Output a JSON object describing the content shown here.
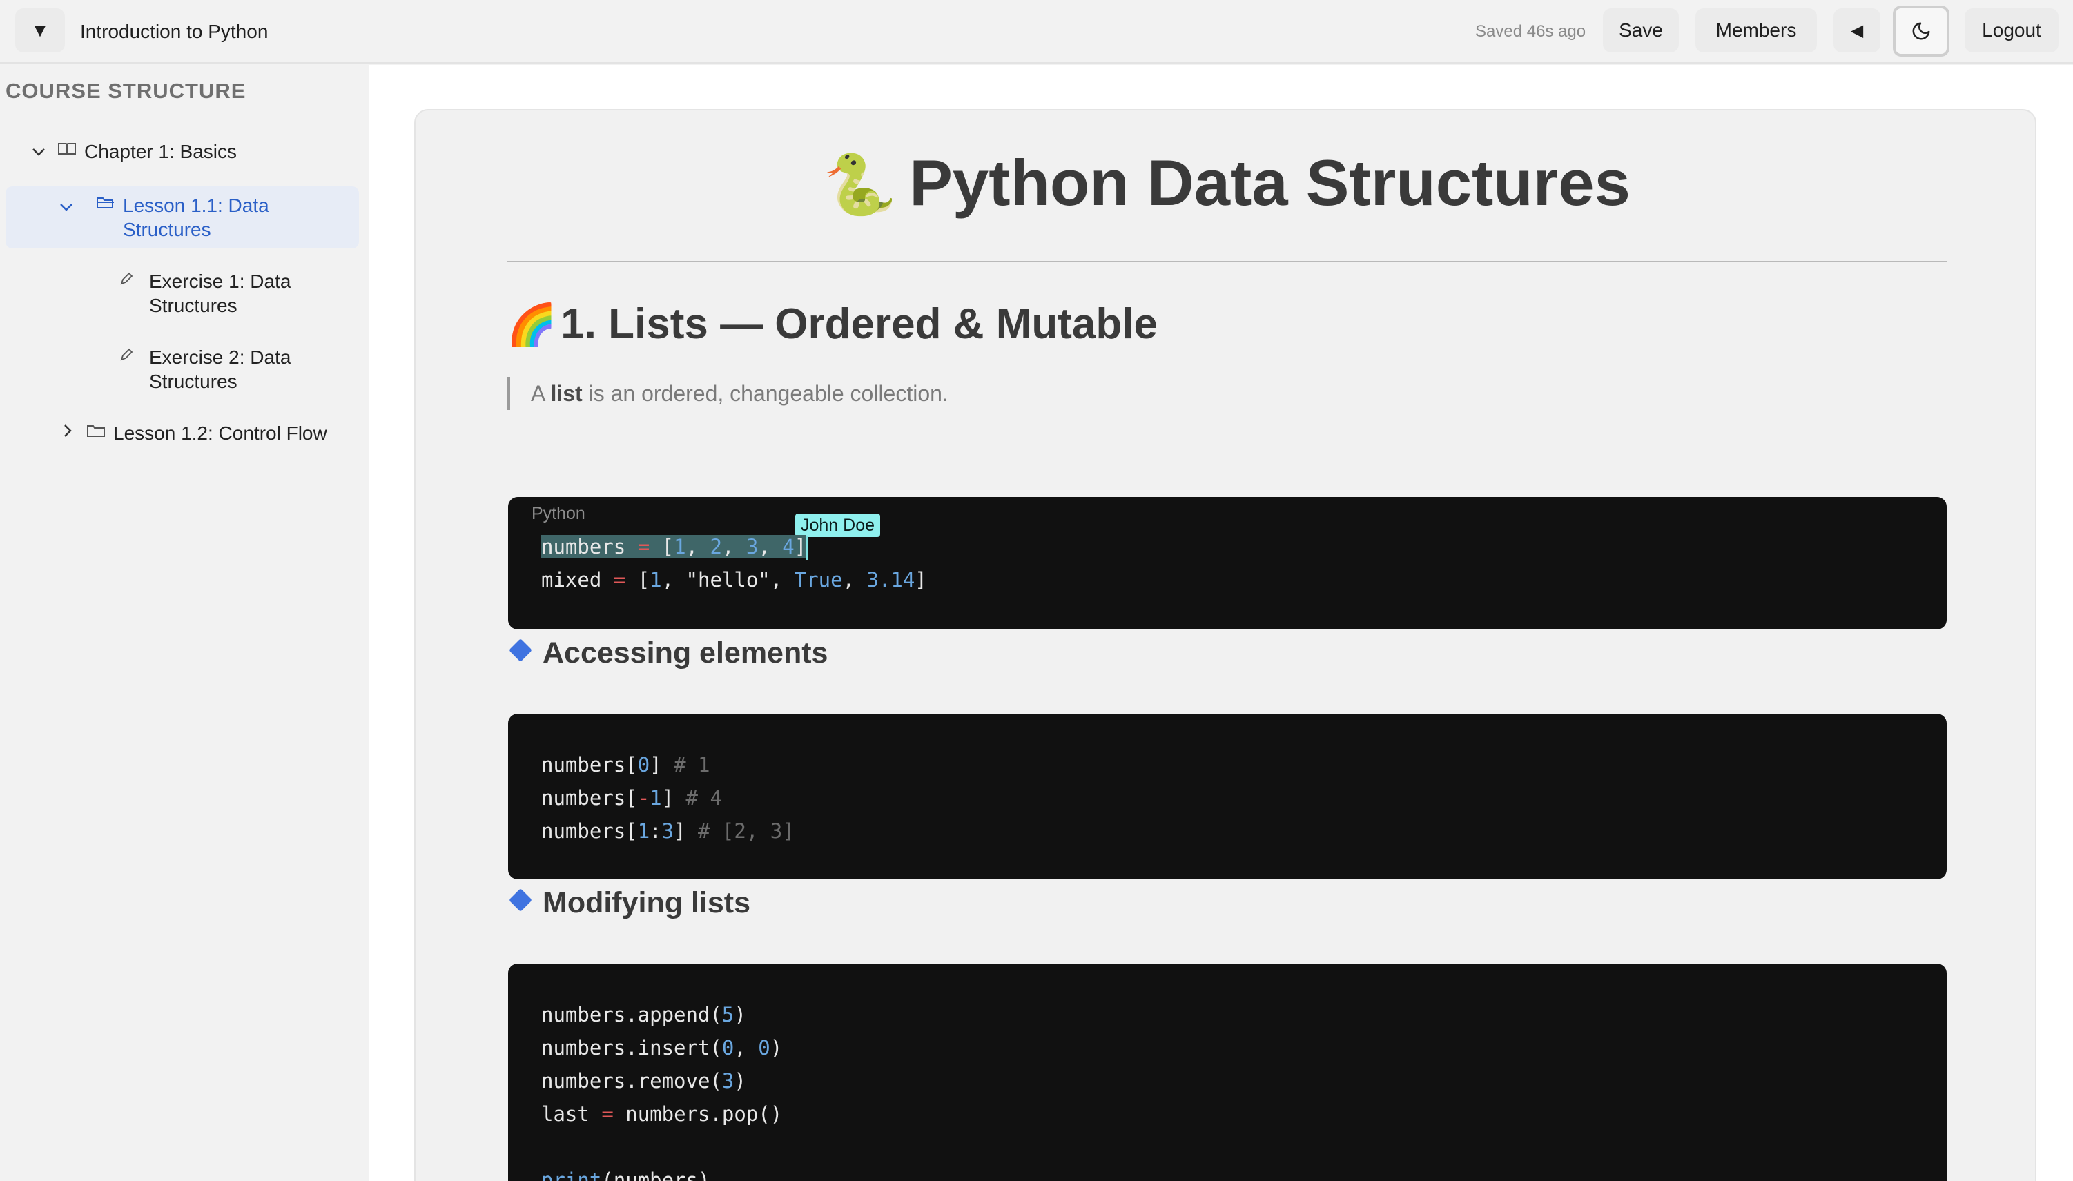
{
  "topbar": {
    "menu_toggle": "▼",
    "title": "Introduction to Python",
    "saved_status": "Saved 46s ago",
    "save_label": "Save",
    "members_label": "Members",
    "collapse_label": "◀",
    "logout_label": "Logout"
  },
  "sidebar": {
    "heading": "COURSE STRUCTURE",
    "items": [
      {
        "label": "Chapter 1: Basics",
        "icon": "book-icon",
        "chevron": "∨"
      },
      {
        "label": "Lesson 1.1: Data Structures",
        "icon": "folder-open-icon",
        "chevron": "∨"
      },
      {
        "label": "Exercise 1: Data Structures",
        "icon": "pencil-icon"
      },
      {
        "label": "Exercise 2: Data Structures",
        "icon": "pencil-icon"
      },
      {
        "label": "Lesson 1.2: Control Flow",
        "icon": "folder-icon",
        "chevron": ">"
      }
    ]
  },
  "document": {
    "title_emoji": "🐍",
    "title": "Python Data Structures",
    "section_emoji": "🌈",
    "section_title": "1. Lists — Ordered & Mutable",
    "quote_prefix": "A",
    "quote_bold": "list",
    "quote_suffix": "is an ordered, changeable collection.",
    "code_language": "Python",
    "collaborator": "John Doe",
    "sub1": "Accessing elements",
    "sub2": "Modifying lists"
  },
  "colors": {
    "accent": "#2a5fc7",
    "code_bg": "#111111",
    "number": "#6aa7e0",
    "operator": "#e05858",
    "collaborator_tag": "#8ff0ee"
  }
}
